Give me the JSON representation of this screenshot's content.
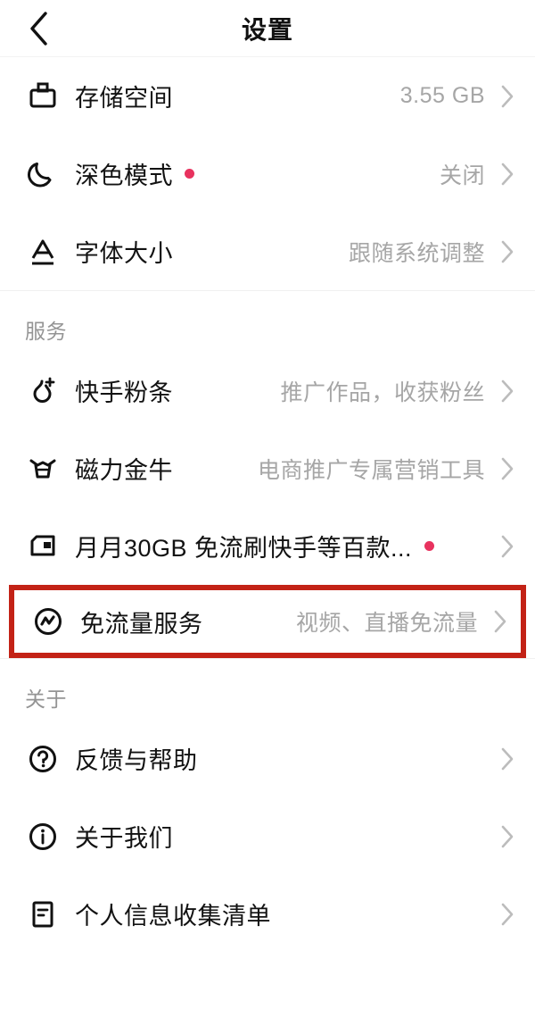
{
  "header": {
    "back_icon": "chevron-left-icon",
    "title": "设置"
  },
  "sections": [
    {
      "id": "display",
      "title": "",
      "rows": [
        {
          "icon": "storage-icon",
          "label": "存储空间",
          "value": "3.55 GB",
          "dot": false,
          "chevron": true
        },
        {
          "icon": "moon-icon",
          "label": "深色模式",
          "value": "关闭",
          "dot": true,
          "chevron": true
        },
        {
          "icon": "font-size-icon",
          "label": "字体大小",
          "value": "跟随系统调整",
          "dot": false,
          "chevron": true
        }
      ]
    },
    {
      "id": "services",
      "title": "服务",
      "rows": [
        {
          "icon": "flame-plus-icon",
          "label": "快手粉条",
          "value": "推广作品，收获粉丝",
          "dot": false,
          "chevron": true
        },
        {
          "icon": "bull-icon",
          "label": "磁力金牛",
          "value": "电商推广专属营销工具",
          "dot": false,
          "chevron": true
        },
        {
          "icon": "sim-card-icon",
          "label": "月月30GB 免流刷快手等百款...",
          "value": "",
          "dot": true,
          "chevron": true
        }
      ]
    },
    {
      "id": "about",
      "title": "关于",
      "rows": [
        {
          "icon": "question-circle-icon",
          "label": "反馈与帮助",
          "value": "",
          "dot": false,
          "chevron": true
        },
        {
          "icon": "info-circle-icon",
          "label": "关于我们",
          "value": "",
          "dot": false,
          "chevron": true
        },
        {
          "icon": "document-list-icon",
          "label": "个人信息收集清单",
          "value": "",
          "dot": false,
          "chevron": true
        }
      ]
    }
  ],
  "highlighted_row": {
    "icon": "free-data-circle-icon",
    "label": "免流量服务",
    "value": "视频、直播免流量",
    "chevron": true,
    "highlight_color": "#c32216"
  },
  "colors": {
    "background": "#ffffff",
    "primary_text": "#121212",
    "secondary_text": "#a6a6a6",
    "section_text": "#949494",
    "badge_dot": "#e8325e",
    "highlight_border": "#c32216",
    "divider": "#f4f4f4"
  }
}
